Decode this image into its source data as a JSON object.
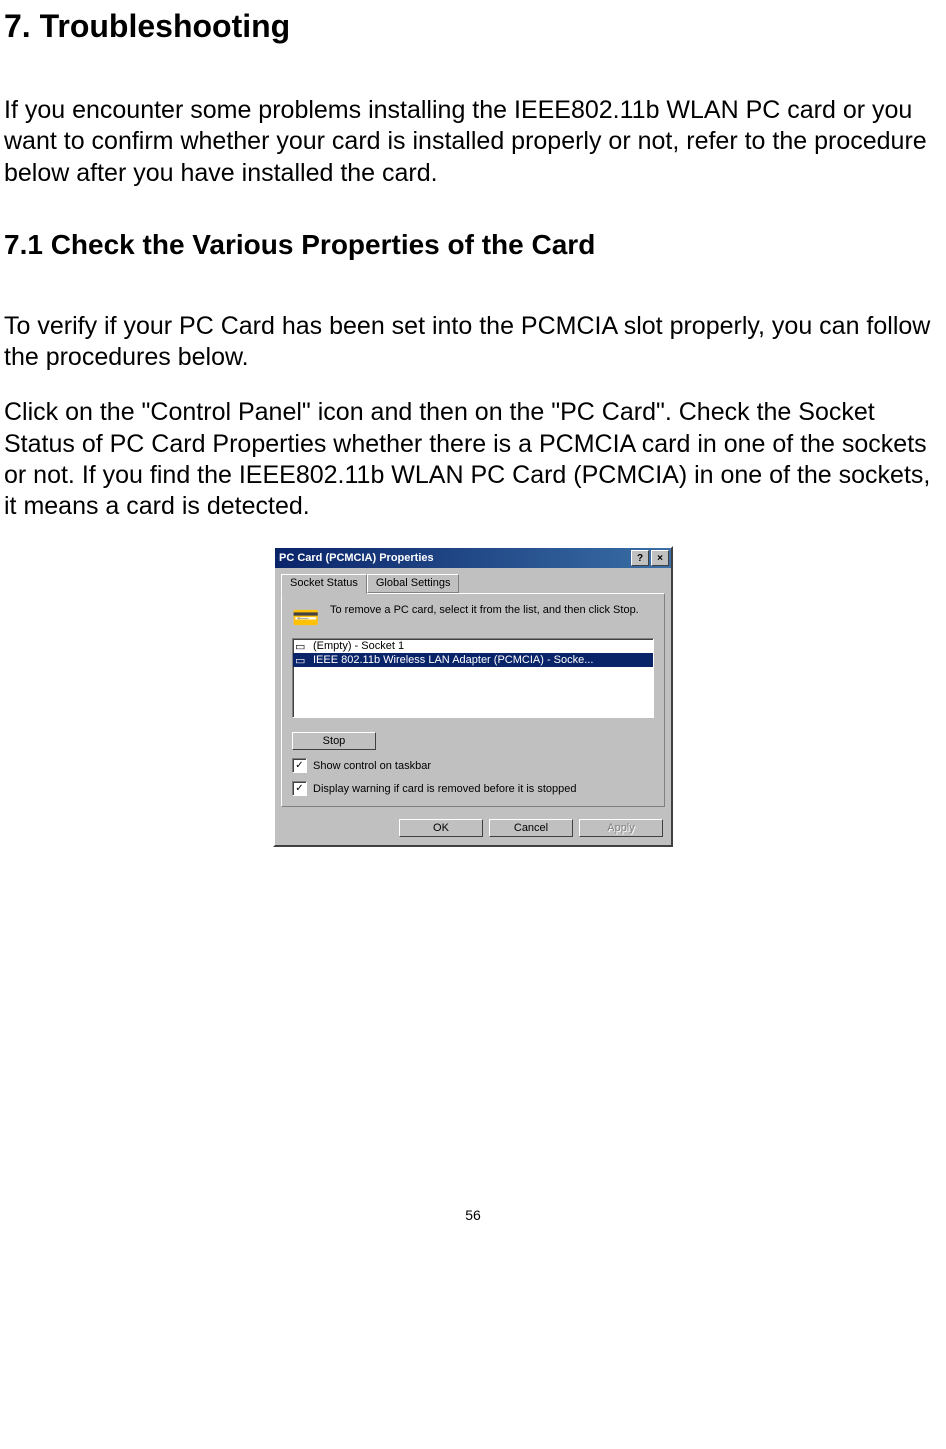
{
  "doc": {
    "heading": "7. Troubleshooting",
    "intro": "If you encounter some problems installing the IEEE802.11b WLAN PC card or you want to confirm whether your card is installed properly or not, refer to the procedure below after you have installed the card.",
    "subheading": "7.1 Check the Various Properties of the Card",
    "para1": "To verify if your PC Card has been set into the PCMCIA slot properly, you can follow the procedures below.",
    "para2": "Click on the \"Control Panel\" icon and then on the \"PC Card\". Check the Socket Status of PC Card Properties whether there is a PCMCIA card in one of the sockets or not. If you find the IEEE802.11b WLAN PC Card (PCMCIA) in one of the sockets, it means a card is detected.",
    "page_number": "56"
  },
  "dialog": {
    "title": "PC Card (PCMCIA) Properties",
    "help_glyph": "?",
    "close_glyph": "×",
    "tabs": {
      "active": "Socket Status",
      "inactive": "Global Settings"
    },
    "instruction": "To remove a PC card, select it from the list, and then click Stop.",
    "list": {
      "item0": "(Empty) - Socket 1",
      "item1": "IEEE 802.11b Wireless LAN Adapter (PCMCIA) - Socke..."
    },
    "buttons": {
      "stop": "Stop",
      "ok": "OK",
      "cancel": "Cancel",
      "apply": "Apply"
    },
    "checks": {
      "taskbar": "Show control on taskbar",
      "warning": "Display warning if card is removed before it is stopped"
    }
  }
}
